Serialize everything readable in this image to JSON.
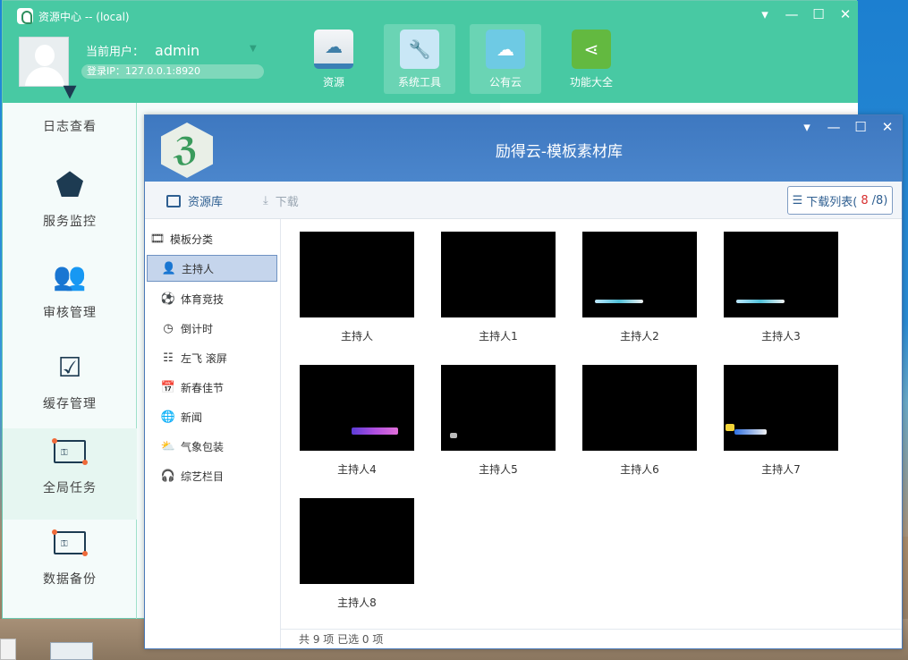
{
  "app": {
    "title": "资源中心 -- (local)",
    "controls": {
      "menu": "▾",
      "minimize": "—",
      "maximize": "☐",
      "close": "✕"
    },
    "user": {
      "label": "当前用户：",
      "name": "admin",
      "login_ip": "登录IP：127.0.0.1:8920"
    },
    "nav": [
      {
        "label": "资源",
        "icon": "cloud-drive-icon",
        "active": false
      },
      {
        "label": "系统工具",
        "icon": "wrench-icon",
        "active": true
      },
      {
        "label": "公有云",
        "icon": "cloud-tablet-icon",
        "active": true
      },
      {
        "label": "功能大全",
        "icon": "share-icon",
        "active": false
      }
    ],
    "sidebar": [
      {
        "label": "日志查看",
        "icon": "log-icon"
      },
      {
        "label": "服务监控",
        "icon": "location-pin-icon"
      },
      {
        "label": "审核管理",
        "icon": "people-icon"
      },
      {
        "label": "缓存管理",
        "icon": "checklist-icon"
      },
      {
        "label": "全局任务",
        "icon": "key-frame-icon",
        "active": true
      },
      {
        "label": "数据备份",
        "icon": "key-frame-icon"
      }
    ]
  },
  "dialog": {
    "title": "励得云-模板素材库",
    "controls": {
      "menu": "▾",
      "minimize": "—",
      "maximize": "☐",
      "close": "✕"
    },
    "toolbar": {
      "library": "资源库",
      "download": "下载",
      "download_list": "下载列表(",
      "download_count": "8",
      "download_total": "/8)"
    },
    "categories_header": "模板分类",
    "categories": [
      {
        "label": "主持人",
        "icon": "person-icon",
        "active": true
      },
      {
        "label": "体育竞技",
        "icon": "soccer-icon"
      },
      {
        "label": "倒计时",
        "icon": "clock-icon"
      },
      {
        "label": "左飞 滚屏",
        "icon": "scroll-icon"
      },
      {
        "label": "新春佳节",
        "icon": "calendar-icon"
      },
      {
        "label": "新闻",
        "icon": "globe-icon"
      },
      {
        "label": "气象包装",
        "icon": "weather-icon"
      },
      {
        "label": "综艺栏目",
        "icon": "headphones-icon"
      }
    ],
    "templates": [
      {
        "label": "主持人"
      },
      {
        "label": "主持人1"
      },
      {
        "label": "主持人2"
      },
      {
        "label": "主持人3"
      },
      {
        "label": "主持人4"
      },
      {
        "label": "主持人5"
      },
      {
        "label": "主持人6"
      },
      {
        "label": "主持人7"
      },
      {
        "label": "主持人8"
      }
    ],
    "status": "共 9 项 已选 0 项"
  }
}
